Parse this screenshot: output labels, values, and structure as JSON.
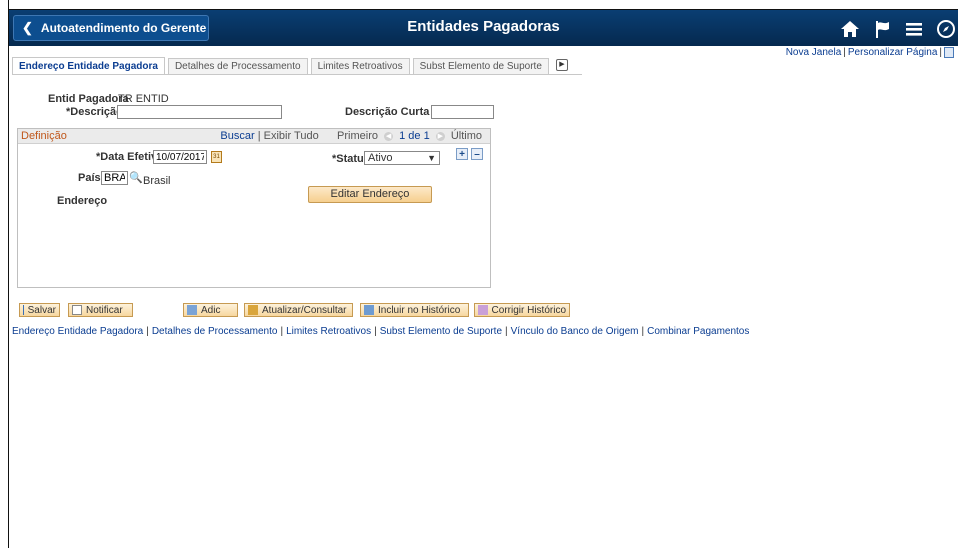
{
  "header": {
    "back_label": "Autoatendimento do Gerente",
    "title": "Entidades Pagadoras"
  },
  "top_links": {
    "new_window": "Nova Janela",
    "personalize": "Personalizar Página"
  },
  "tabs": [
    {
      "label": "Endereço Entidade Pagadora",
      "active": true
    },
    {
      "label": "Detalhes de Processamento",
      "active": false
    },
    {
      "label": "Limites Retroativos",
      "active": false
    },
    {
      "label": "Subst Elemento de Suporte",
      "active": false
    }
  ],
  "form": {
    "entid_label": "Entid Pagadora",
    "entid_value": "TR ENTID",
    "descricao_label": "*Descrição",
    "descricao_value": "",
    "descricao_curta_label": "Descrição Curta",
    "descricao_curta_value": ""
  },
  "group": {
    "title": "Definição",
    "buscar": "Buscar",
    "exibir_tudo": "Exibir Tudo",
    "primeiro": "Primeiro",
    "pager": "1 de 1",
    "ultimo": "Último",
    "data_efetiva_label": "*Data Efetiva",
    "data_efetiva_value": "10/07/2017",
    "status_label": "*Status",
    "status_value": "Ativo",
    "pais_label": "País",
    "pais_value": "BRA",
    "pais_desc": "Brasil",
    "endereco_label": "Endereço",
    "editar_endereco": "Editar Endereço"
  },
  "toolbar": {
    "salvar": "Salvar",
    "notificar": "Notificar",
    "adic": "Adic",
    "atualizar": "Atualizar/Consultar",
    "incluir": "Incluir no Histórico",
    "corrigir": "Corrigir Histórico"
  },
  "bottom_links": [
    "Endereço Entidade Pagadora",
    "Detalhes de Processamento",
    "Limites Retroativos",
    "Subst Elemento de Suporte",
    "Vínculo do Banco de Origem",
    "Combinar Pagamentos"
  ],
  "colors": {
    "banner": "#05294f",
    "link": "#0b3d91",
    "group_title": "#c0571b",
    "button": "#f6cf8f"
  }
}
